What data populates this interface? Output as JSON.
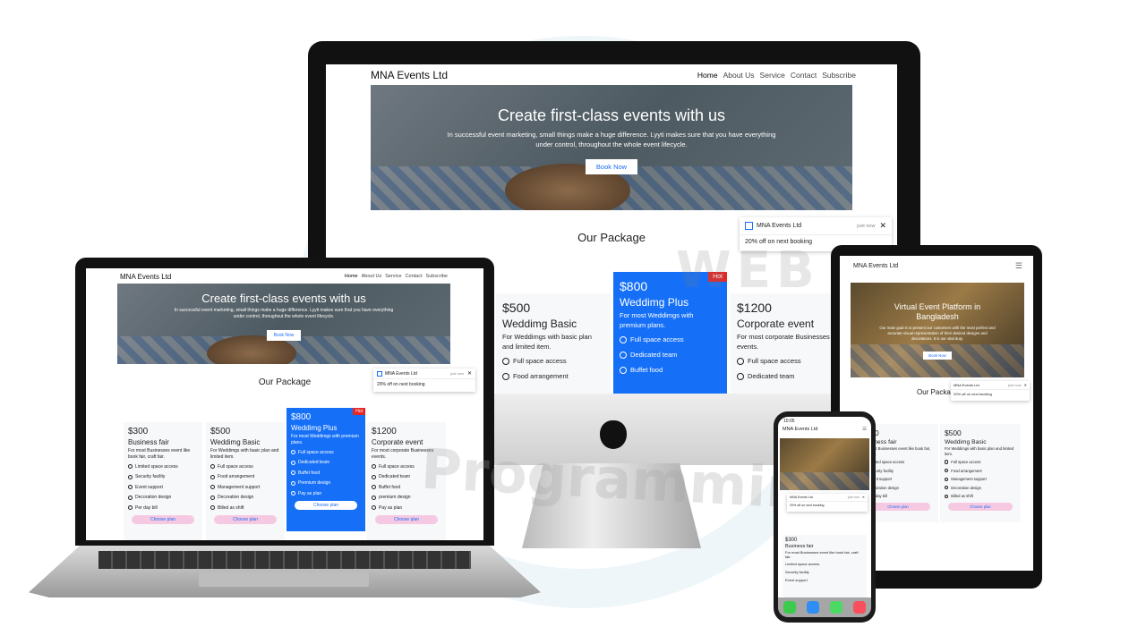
{
  "site": {
    "brand": "MNA Events Ltd",
    "menu": [
      "Home",
      "About Us",
      "Service",
      "Contact",
      "Subscribe"
    ]
  },
  "hero": {
    "title": "Create first-class events with us",
    "text": "In successful event marketing, small things make a huge difference. Lyyti makes sure that you have everything under control, throughout the whole event lifecycle.",
    "button": "Book Now"
  },
  "hero_mobile": {
    "title": "Virtual Event Platform in Bangladesh",
    "text": "Our main goal is to present our customers with the most perfect and accurate visual representation of their desired designs and decorations. It is our vital duty.",
    "button": "Book Now"
  },
  "section_title": "Our Package",
  "toast": {
    "title": "MNA Events Ltd",
    "time": "just now",
    "message": "20% off on next booking"
  },
  "packages": [
    {
      "price": "$300",
      "name": "Business fair",
      "desc": "For most Businesses event like book fair, craft fair.",
      "features": [
        "Limited space access",
        "Security facility",
        "Event support",
        "Decoration design",
        "Per day bill"
      ],
      "button": "Choose plan",
      "hot": false
    },
    {
      "price": "$500",
      "name": "Weddimg Basic",
      "desc": "For Weddimgs with basic plan and limited item.",
      "features": [
        "Full space access",
        "Food arrangement",
        "Management support",
        "Decoration design",
        "Billed as shift"
      ],
      "button": "Choose plan",
      "hot": false
    },
    {
      "price": "$800",
      "name": "Weddimg Plus",
      "desc": "For most Weddimgs with premium plans.",
      "features": [
        "Full space access",
        "Dedicated team",
        "Buffet food",
        "Premium design",
        "Pay as plan"
      ],
      "button": "Choose plan",
      "hot": true
    },
    {
      "price": "$1200",
      "name": "Corporate event",
      "desc": "For most corporate Businesses events.",
      "features": [
        "Full space access",
        "Dedicated team",
        "Buffet food",
        "premium design",
        "Pay as plan"
      ],
      "button": "Choose plan",
      "hot": false
    }
  ],
  "hot_label": "Hot",
  "phone": {
    "time": "10:05"
  },
  "watermark": {
    "big": "WEB",
    "word": "Programming"
  },
  "colors": {
    "accent": "#1670f7",
    "hot": "#e52727",
    "choose_btn": "#f6c9e3"
  }
}
